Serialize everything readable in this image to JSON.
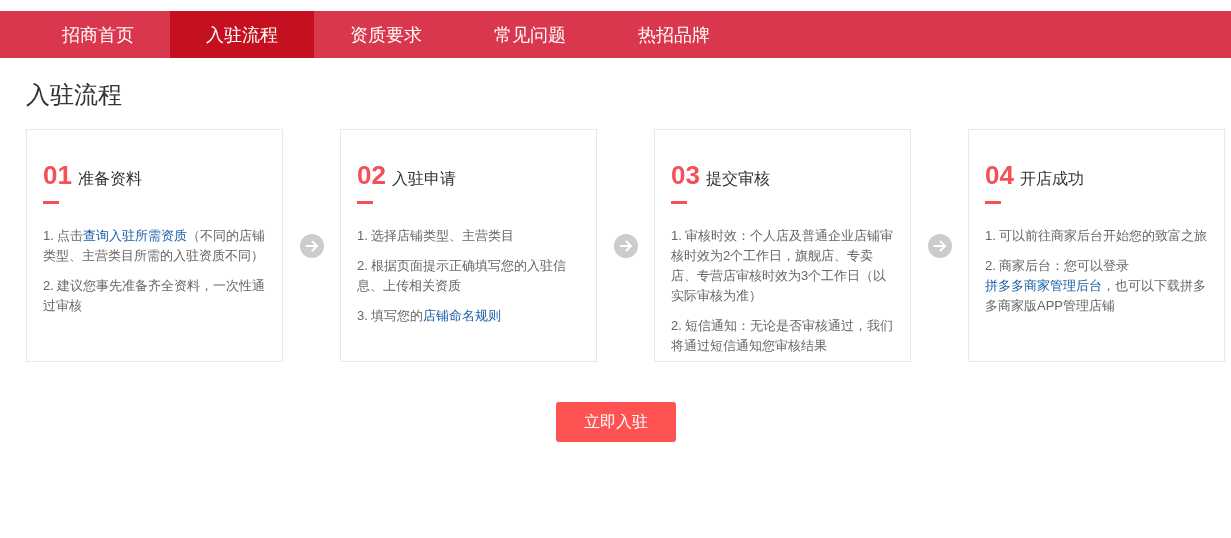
{
  "nav": {
    "tabs": [
      {
        "label": "招商首页",
        "selected": false
      },
      {
        "label": "入驻流程",
        "selected": true
      },
      {
        "label": "资质要求",
        "selected": false
      },
      {
        "label": "常见问题",
        "selected": false
      },
      {
        "label": "热招品牌",
        "selected": false
      }
    ]
  },
  "heading": "入驻流程",
  "steps": [
    {
      "number": "01",
      "title": "准备资料",
      "paragraphs": [
        [
          {
            "text": "1. 点击"
          },
          {
            "text": "查询入驻所需资质",
            "link": true
          },
          {
            "text": "（不同的店铺类型、主营类目所需的入驻资质不同）"
          }
        ],
        [
          {
            "text": "2. 建议您事先准备齐全资料，一次性通过审核"
          }
        ]
      ]
    },
    {
      "number": "02",
      "title": "入驻申请",
      "paragraphs": [
        [
          {
            "text": "1. 选择店铺类型、主营类目"
          }
        ],
        [
          {
            "text": "2. 根据页面提示正确填写您的入驻信息、上传相关资质"
          }
        ],
        [
          {
            "text": "3. 填写您的"
          },
          {
            "text": "店铺命名规则",
            "link": true
          }
        ]
      ]
    },
    {
      "number": "03",
      "title": "提交审核",
      "paragraphs": [
        [
          {
            "text": "1. 审核时效：个人店及普通企业店铺审核时效为2个工作日，旗舰店、专卖店、专营店审核时效为3个工作日（以实际审核为准）"
          }
        ],
        [
          {
            "text": "2. 短信通知：无论是否审核通过，我们将通过短信通知您审核结果"
          }
        ]
      ]
    },
    {
      "number": "04",
      "title": "开店成功",
      "paragraphs": [
        [
          {
            "text": "1. 可以前往商家后台开始您的致富之旅"
          }
        ],
        [
          {
            "text": "2. 商家后台：您可以登录"
          },
          {
            "text": "拼多多商家管理后台",
            "link": true
          },
          {
            "text": "，也可以下载拼多多商家版APP管理店铺"
          }
        ]
      ]
    }
  ],
  "cta": "立即入驻"
}
